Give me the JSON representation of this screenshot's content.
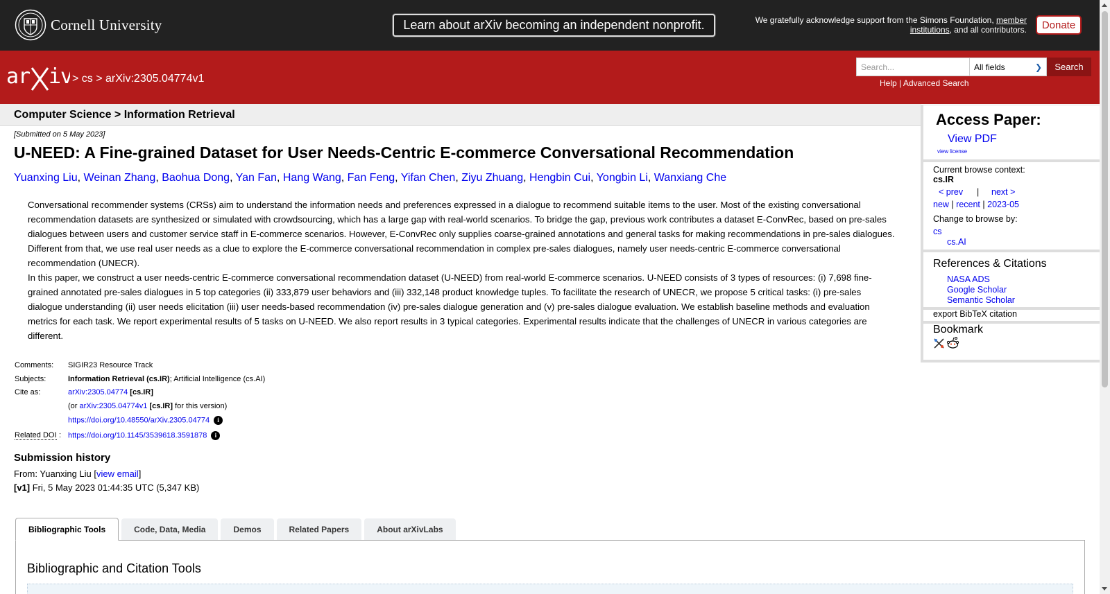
{
  "top_bar": {
    "university": "Cornell University",
    "announcement": "Learn about arXiv becoming an independent nonprofit.",
    "ack_text_1": "We gratefully acknowledge support from the Simons Foundation, ",
    "ack_link": "member institutions",
    "ack_text_2": ", and all contributors.",
    "donate_label": "Donate"
  },
  "header": {
    "logo": "arXiv",
    "breadcrumb_sep1": " > ",
    "breadcrumb_cs": "cs",
    "breadcrumb_sep2": " > ",
    "breadcrumb_id": "arXiv:2305.04774v1",
    "search_placeholder": "Search...",
    "search_field": "All fields",
    "search_button": "Search",
    "help_link": "Help",
    "link_sep": " | ",
    "advanced_link": "Advanced Search"
  },
  "main": {
    "subject_header": "Computer Science > Information Retrieval",
    "dateline": "[Submitted on 5 May 2023]",
    "title": "U-NEED: A Fine-grained Dataset for User Needs-Centric E-commerce Conversational Recommendation",
    "authors": [
      "Yuanxing Liu",
      "Weinan Zhang",
      "Baohua Dong",
      "Yan Fan",
      "Hang Wang",
      "Fan Feng",
      "Yifan Chen",
      "Ziyu Zhuang",
      "Hengbin Cui",
      "Yongbin Li",
      "Wanxiang Che"
    ],
    "abstract_p1": "Conversational recommender systems (CRSs) aim to understand the information needs and preferences expressed in a dialogue to recommend suitable items to the user. Most of the existing conversational recommendation datasets are synthesized or simulated with crowdsourcing, which has a large gap with real-world scenarios. To bridge the gap, previous work contributes a dataset E-ConvRec, based on pre-sales dialogues between users and customer service staff in E-commerce scenarios. However, E-ConvRec only supplies coarse-grained annotations and general tasks for making recommendations in pre-sales dialogues. Different from that, we use real user needs as a clue to explore the E-commerce conversational recommendation in complex pre-sales dialogues, namely user needs-centric E-commerce conversational recommendation (UNECR).",
    "abstract_p2": "In this paper, we construct a user needs-centric E-commerce conversational recommendation dataset (U-NEED) from real-world E-commerce scenarios. U-NEED consists of 3 types of resources: (i) 7,698 fine-grained annotated pre-sales dialogues in 5 top categories (ii) 333,879 user behaviors and (iii) 332,148 product knowledge tuples. To facilitate the research of UNECR, we propose 5 critical tasks: (i) pre-sales dialogue understanding (ii) user needs elicitation (iii) user needs-based recommendation (iv) pre-sales dialogue generation and (v) pre-sales dialogue evaluation. We establish baseline methods and evaluation metrics for each task. We report experimental results of 5 tasks on U-NEED. We also report results in 3 typical categories. Experimental results indicate that the challenges of UNECR in various categories are different.",
    "meta": {
      "comments_label": "Comments:",
      "comments": "SIGIR23 Resource Track",
      "subjects_label": "Subjects:",
      "subjects_primary": "Information Retrieval (cs.IR)",
      "subjects_rest": "; Artificial Intelligence (cs.AI)",
      "cite_label": "Cite as:",
      "cite_id": "arXiv:2305.04774",
      "cite_tag": " [cs.IR]",
      "cite_or": "(or ",
      "cite_v_id": "arXiv:2305.04774v1",
      "cite_v_tag": " [cs.IR]",
      "cite_v_suffix": " for this version)",
      "doi_link": "https://doi.org/10.48550/arXiv.2305.04774",
      "related_label": "Related DOI",
      "related_colon": ":",
      "related_doi": "https://doi.org/10.1145/3539618.3591878"
    },
    "history": {
      "title": "Submission history",
      "from_prefix": "From: Yuanxing Liu [",
      "view_email": "view email",
      "from_suffix": "]",
      "v1_label": "[v1]",
      "v1_text": " Fri, 5 May 2023 01:44:35 UTC (5,347 KB)"
    },
    "tabs": [
      "Bibliographic Tools",
      "Code, Data, Media",
      "Demos",
      "Related Papers",
      "About arXivLabs"
    ],
    "active_tab": "Bibliographic Tools",
    "panel_title": "Bibliographic and Citation Tools"
  },
  "sidebar": {
    "access_title": "Access Paper:",
    "view_pdf": "View PDF",
    "view_license": "view license",
    "context_label": "Current browse context:",
    "context_value": "cs.IR",
    "prev": "< prev",
    "pipe": "|",
    "next": "next >",
    "new": "new",
    "recent": "recent",
    "month": "2023-05",
    "change_label": "Change to browse by:",
    "browse_cs": "cs",
    "browse_csai": "cs.AI",
    "refs_title": "References & Citations",
    "nasa": "NASA ADS",
    "google": "Google Scholar",
    "semantic": "Semantic Scholar",
    "bibtex": "export BibTeX citation",
    "bookmark_title": "Bookmark"
  },
  "colors": {
    "arxiv_red": "#b31b1b",
    "top_bar": "#222222",
    "link": "#0000ee"
  }
}
